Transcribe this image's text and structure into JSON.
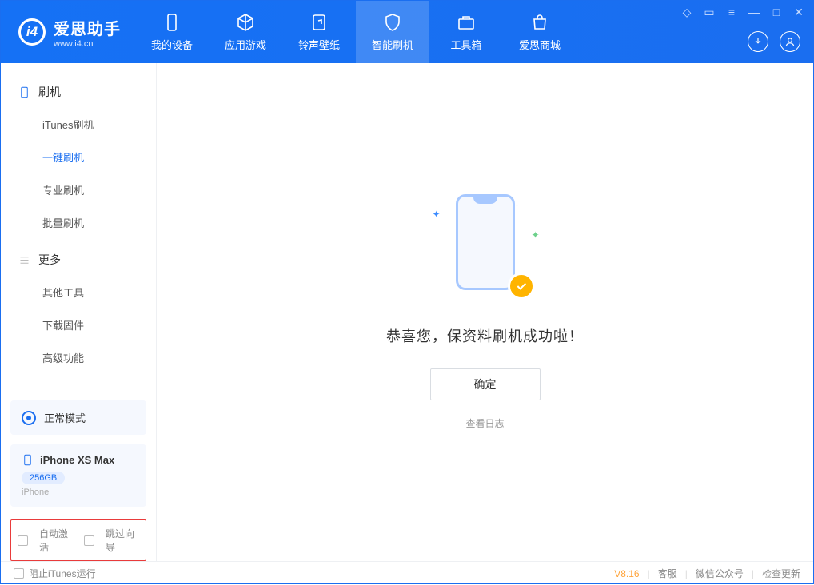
{
  "app": {
    "title": "爱思助手",
    "subtitle": "www.i4.cn"
  },
  "nav": {
    "items": [
      {
        "label": "我的设备"
      },
      {
        "label": "应用游戏"
      },
      {
        "label": "铃声壁纸"
      },
      {
        "label": "智能刷机"
      },
      {
        "label": "工具箱"
      },
      {
        "label": "爱思商城"
      }
    ]
  },
  "sidebar": {
    "section1": {
      "title": "刷机",
      "items": [
        "iTunes刷机",
        "一键刷机",
        "专业刷机",
        "批量刷机"
      ]
    },
    "section2": {
      "title": "更多",
      "items": [
        "其他工具",
        "下载固件",
        "高级功能"
      ]
    },
    "mode": "正常模式",
    "device": {
      "name": "iPhone XS Max",
      "storage": "256GB",
      "type": "iPhone"
    },
    "checks": {
      "auto_activate": "自动激活",
      "skip_guide": "跳过向导"
    }
  },
  "main": {
    "success_message": "恭喜您，保资料刷机成功啦！",
    "ok_button": "确定",
    "view_log": "查看日志"
  },
  "footer": {
    "block_itunes": "阻止iTunes运行",
    "version": "V8.16",
    "link_service": "客服",
    "link_wechat": "微信公众号",
    "link_update": "检查更新"
  }
}
